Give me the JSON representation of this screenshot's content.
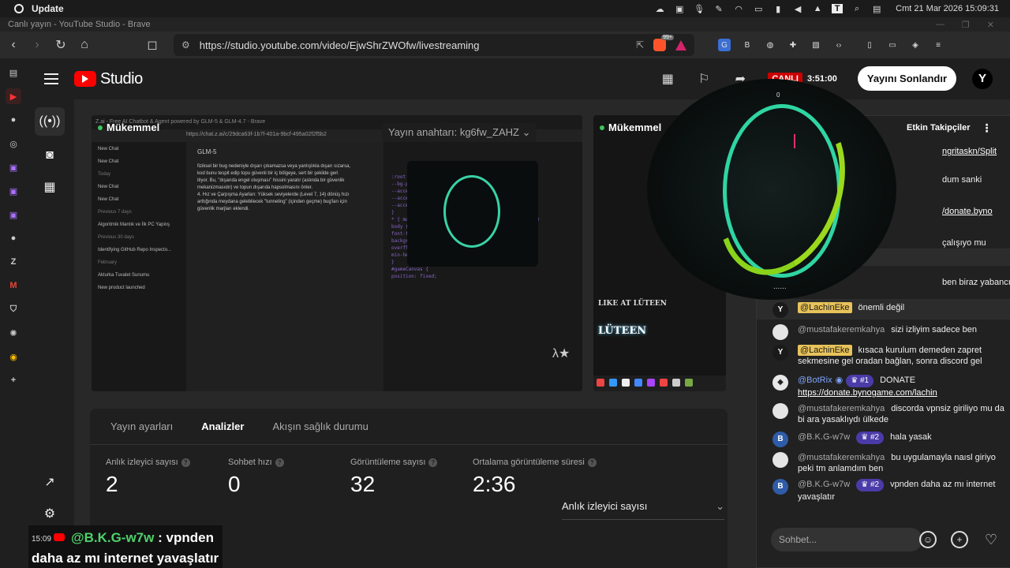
{
  "os": {
    "title": "Update",
    "clock": "Cmt 21 Mar 2026 15:09:31"
  },
  "window": {
    "title": "Canlı yayın - YouTube Studio - Brave"
  },
  "browser": {
    "url": "https://studio.youtube.com/video/EjwShrZWOfw/livestreaming",
    "brave_badge": "99+"
  },
  "studio": {
    "logo": "Studio",
    "live_label": "CANLI",
    "live_time": "3:51:00",
    "end_stream_label": "Yayını Sonlandır",
    "avatar_letter": "Y"
  },
  "preview": {
    "label": "Mükemmel",
    "stream_key": "Yayın anahtarı: kg6fw_ZAHZ",
    "top_title": "Z.ai - Free AI Chatbot & Agent powered by GLM-5 & GLM-4.7 - Brave",
    "url": "https://chat.z.ai/c/29dca63f-1b7f-401a-9bcf-495a02f2f5b2",
    "side_items": [
      "New Chat",
      "New Chat",
      "Today",
      "New Chat",
      "New Chat",
      "Previous 7 days",
      "Algoritmik Mantık ve İlk PC Yapılış",
      "Previous 30 days",
      "Identifying GitHub Repo Inspecto...",
      "February",
      "Akturka Tuvalet Sunumu",
      "New product launched"
    ],
    "chat_title": "GLM-5",
    "chat_lines": [
      "fiziksel bir bug nedeniyle dışarı çıkamazsa veya yanlışlıkla dışarı sızarsa,",
      "kod bunu tespit edip topu güvenli bir iç bölgeye, sert bir şekilde geri",
      "itiyor. Bu, \"dışarıda engel oluşması\" hissini yaratır (aslında bir güvenlik",
      "mekanizmasıdır) ve topun dışarıda hapsolmasını önler.",
      "4. Hız ve Çarpışma Ayarları: Yüksek seviyelerde (Level 7, 14) dönüş hızı",
      "arttığında meydana gelebilecek \"tunneling\" (içinden geçme) bug'ları için",
      "güvenlik marjları eklendi."
    ],
    "code_lines": [
      ":root {",
      "--bg-primary: #050508;",
      "--accent-cyan: #00f5d4;",
      "--accent-magenta: #f72585;",
      "--accent-gold: #ffd60a;",
      "}",
      "* { margin: 0; padding: 0; box-sizing: border-box; }",
      "body {",
      "font-family: 'Space Grotesk', sans-serif;",
      "background: var(--bg-primary);",
      "overflow: hidden;",
      "min-height: 100vh;",
      "}",
      "#gameCanvas {",
      "position: fixed;"
    ],
    "lambda": "λ★"
  },
  "preview2": {
    "label": "Mükemmel",
    "like": "LIKE AT LÜTEEN",
    "luteen": "LÜTEEN"
  },
  "tabs": [
    "Yayın ayarları",
    "Analizler",
    "Akışın sağlık durumu"
  ],
  "metrics": [
    {
      "label": "Anlık izleyici sayısı",
      "value": "2"
    },
    {
      "label": "Sohbet hızı",
      "value": "0"
    },
    {
      "label": "Görüntüleme sayısı",
      "value": "32"
    },
    {
      "label": "Ortalama görüntüleme süresi",
      "value": "2:36"
    }
  ],
  "dropdown": {
    "value": "Anlık izleyici sayısı"
  },
  "chat": {
    "header": "Etkin Takipçiler",
    "partial_lines": [
      "ngritaskn/Split",
      "dum sanki",
      "/donate.byno",
      "çalışıyo mu",
      "ben biraz yabancıyım"
    ],
    "messages": [
      {
        "user": "@LachinEke",
        "text": "önemli değil"
      },
      {
        "user": "@mustafakeremkahya",
        "text": "sizi izliyim sadece ben"
      },
      {
        "user": "@LachinEke",
        "text": "kısaca kurulum demeden zapret sekmesine gel oradan bağlan, sonra discord gel"
      },
      {
        "user": "@BotRix",
        "badge": "#1",
        "text": "DONATE",
        "link": "https://donate.bynogame.com/lachin"
      },
      {
        "user": "@mustafakeremkahya",
        "text": "discorda vpnsiz giriliyo mu da bi ara yasaklıydı ülkede"
      },
      {
        "user": "@B.K.G-w7w",
        "badge": "#2",
        "text": "hala yasak"
      },
      {
        "user": "@mustafakeremkahya",
        "text": "bu uygulamayla naısl giriyo peki tm anlamdım ben"
      },
      {
        "user": "@B.K.G-w7w",
        "badge": "#2",
        "text": "vpnden daha az mı internet yavaşlatır"
      }
    ],
    "input_placeholder": "Sohbet..."
  },
  "game": {
    "score": "0",
    "dots": "......"
  },
  "overlay": {
    "time": "15:09",
    "user": "@B.K.G-w7w",
    "colon": ":",
    "text1": "vpnden",
    "text2": "daha az mı internet yavaşlatır"
  },
  "tiny_axis": "4"
}
